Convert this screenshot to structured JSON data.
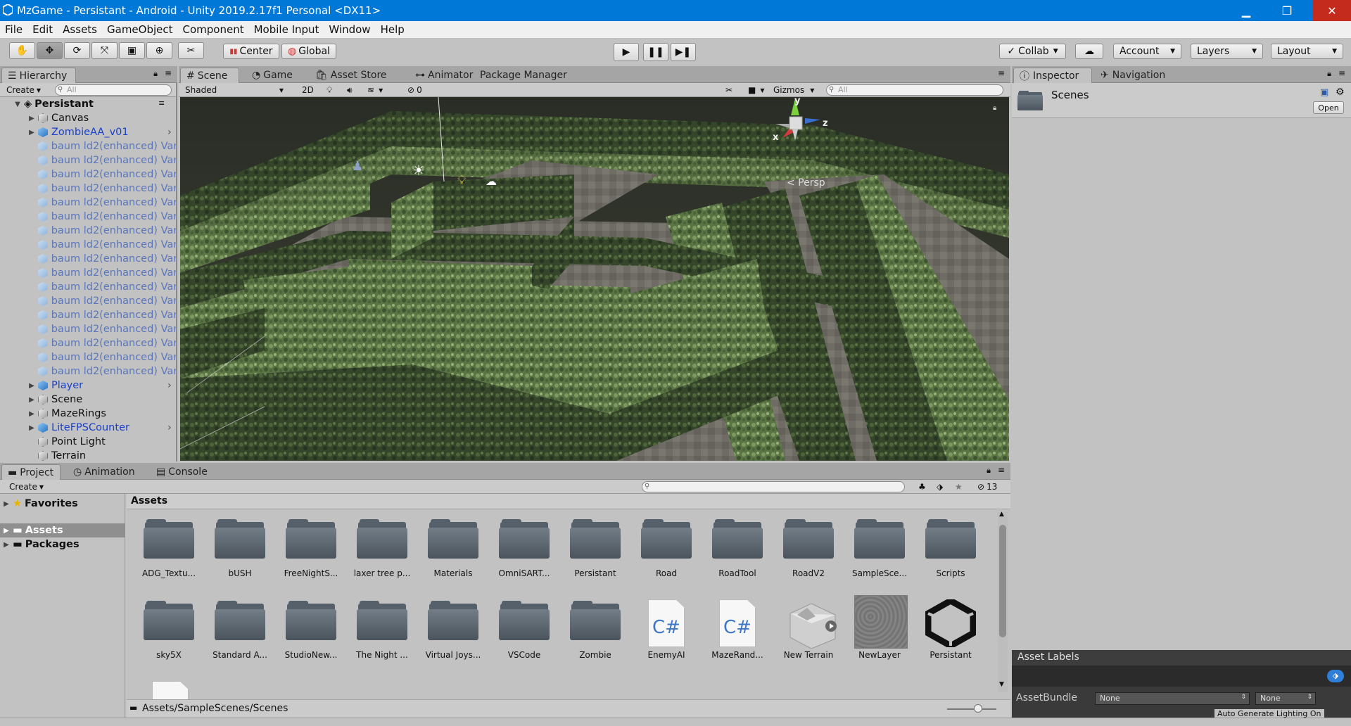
{
  "window": {
    "title": "MzGame - Persistant - Android - Unity 2019.2.17f1 Personal <DX11>",
    "minimize": "▁",
    "maximize": "❐",
    "close": "✕"
  },
  "menu": [
    "File",
    "Edit",
    "Assets",
    "GameObject",
    "Component",
    "Mobile Input",
    "Window",
    "Help"
  ],
  "toolbar": {
    "pivot_label": "Center",
    "space_label": "Global",
    "collab_label": "Collab",
    "account_label": "Account",
    "layers_label": "Layers",
    "layout_label": "Layout"
  },
  "hierarchy": {
    "tab_label": "Hierarchy",
    "create_label": "Create",
    "search_placeholder": "All",
    "scene_name": "Persistant",
    "items": [
      {
        "label": "Canvas",
        "style": "gray",
        "expand": true,
        "color": "#111111",
        "more": false
      },
      {
        "label": "ZombieAA_v01",
        "style": "blue",
        "expand": true,
        "color": "#1a3fc9",
        "more": true
      },
      {
        "label": "baum ld2(enhanced) Var",
        "style": "lightblue",
        "expand": false,
        "color": "#5a75b8",
        "more": false
      },
      {
        "label": "baum ld2(enhanced) Var",
        "style": "lightblue",
        "expand": false,
        "color": "#5a75b8",
        "more": false
      },
      {
        "label": "baum ld2(enhanced) Var",
        "style": "lightblue",
        "expand": false,
        "color": "#5a75b8",
        "more": false
      },
      {
        "label": "baum ld2(enhanced) Var",
        "style": "lightblue",
        "expand": false,
        "color": "#5a75b8",
        "more": false
      },
      {
        "label": "baum ld2(enhanced) Var",
        "style": "lightblue",
        "expand": false,
        "color": "#5a75b8",
        "more": false
      },
      {
        "label": "baum ld2(enhanced) Var",
        "style": "lightblue",
        "expand": false,
        "color": "#5a75b8",
        "more": false
      },
      {
        "label": "baum ld2(enhanced) Var",
        "style": "lightblue",
        "expand": false,
        "color": "#5a75b8",
        "more": false
      },
      {
        "label": "baum ld2(enhanced) Var",
        "style": "lightblue",
        "expand": false,
        "color": "#5a75b8",
        "more": false
      },
      {
        "label": "baum ld2(enhanced) Var",
        "style": "lightblue",
        "expand": false,
        "color": "#5a75b8",
        "more": false
      },
      {
        "label": "baum ld2(enhanced) Var",
        "style": "lightblue",
        "expand": false,
        "color": "#5a75b8",
        "more": false
      },
      {
        "label": "baum ld2(enhanced) Var",
        "style": "lightblue",
        "expand": false,
        "color": "#5a75b8",
        "more": false
      },
      {
        "label": "baum ld2(enhanced) Var",
        "style": "lightblue",
        "expand": false,
        "color": "#5a75b8",
        "more": false
      },
      {
        "label": "baum ld2(enhanced) Var",
        "style": "lightblue",
        "expand": false,
        "color": "#5a75b8",
        "more": false
      },
      {
        "label": "baum ld2(enhanced) Var",
        "style": "lightblue",
        "expand": false,
        "color": "#5a75b8",
        "more": false
      },
      {
        "label": "baum ld2(enhanced) Var",
        "style": "lightblue",
        "expand": false,
        "color": "#5a75b8",
        "more": false
      },
      {
        "label": "baum ld2(enhanced) Var",
        "style": "lightblue",
        "expand": false,
        "color": "#5a75b8",
        "more": false
      },
      {
        "label": "baum ld2(enhanced) Var",
        "style": "lightblue",
        "expand": false,
        "color": "#5a75b8",
        "more": false
      },
      {
        "label": "Player",
        "style": "blue",
        "expand": true,
        "color": "#1a3fc9",
        "more": true
      },
      {
        "label": "Scene",
        "style": "gray",
        "expand": true,
        "color": "#111111",
        "more": false
      },
      {
        "label": "MazeRings",
        "style": "gray",
        "expand": true,
        "color": "#111111",
        "more": false
      },
      {
        "label": "LiteFPSCounter",
        "style": "blue",
        "expand": true,
        "color": "#1a3fc9",
        "more": true
      },
      {
        "label": "Point Light",
        "style": "gray",
        "expand": false,
        "color": "#111111",
        "more": false
      },
      {
        "label": "Terrain",
        "style": "gray",
        "expand": false,
        "color": "#111111",
        "more": false
      }
    ]
  },
  "scene_tabs": {
    "scene": "Scene",
    "game": "Game",
    "asset_store": "Asset Store",
    "animator": "Animator",
    "package_manager": "Package Manager"
  },
  "scene_toolbar": {
    "shading": "Shaded",
    "mode_2d": "2D",
    "hidden_count": "0",
    "gizmos": "Gizmos",
    "search_placeholder": "All",
    "persp_label": "< Persp",
    "axis_x": "x",
    "axis_y": "y",
    "axis_z": "z"
  },
  "inspector": {
    "tab_label": "Inspector",
    "nav_tab_label": "Navigation",
    "selected_name": "Scenes",
    "open_label": "Open",
    "asset_labels_title": "Asset Labels",
    "assetbundle_label": "AssetBundle",
    "bundle_value": "None",
    "variant_value": "None"
  },
  "project": {
    "tabs": {
      "project": "Project",
      "animation": "Animation",
      "console": "Console"
    },
    "create_label": "Create",
    "hidden_count": "13",
    "tree": [
      {
        "label": "Favorites",
        "icon": "star-icon",
        "selected": false
      },
      {
        "label": "Assets",
        "icon": "folder-icon",
        "selected": true
      },
      {
        "label": "Packages",
        "icon": "folder-icon",
        "selected": false
      }
    ],
    "breadcrumb_header": "Assets",
    "path": "Assets/SampleScenes/Scenes",
    "assets": [
      {
        "label": "ADG_Textu...",
        "type": "folder"
      },
      {
        "label": "bUSH",
        "type": "folder"
      },
      {
        "label": "FreeNightS...",
        "type": "folder"
      },
      {
        "label": "laxer tree p...",
        "type": "folder"
      },
      {
        "label": "Materials",
        "type": "folder"
      },
      {
        "label": "OmniSART...",
        "type": "folder"
      },
      {
        "label": "Persistant",
        "type": "folder"
      },
      {
        "label": "Road",
        "type": "folder"
      },
      {
        "label": "RoadTool",
        "type": "folder"
      },
      {
        "label": "RoadV2",
        "type": "folder"
      },
      {
        "label": "SampleSce...",
        "type": "folder"
      },
      {
        "label": "Scripts",
        "type": "folder"
      },
      {
        "label": "sky5X",
        "type": "folder"
      },
      {
        "label": "Standard A...",
        "type": "folder"
      },
      {
        "label": "StudioNew...",
        "type": "folder"
      },
      {
        "label": "The Night ...",
        "type": "folder"
      },
      {
        "label": "Virtual Joys...",
        "type": "folder"
      },
      {
        "label": "VSCode",
        "type": "folder"
      },
      {
        "label": "Zombie",
        "type": "folder"
      },
      {
        "label": "EnemyAI",
        "type": "script"
      },
      {
        "label": "MazeRand...",
        "type": "script"
      },
      {
        "label": "New Terrain",
        "type": "terrain"
      },
      {
        "label": "NewLayer",
        "type": "layer"
      },
      {
        "label": "Persistant",
        "type": "scene"
      }
    ]
  },
  "status": {
    "right_text": "Auto Generate Lighting On"
  },
  "colors": {
    "title_bar": "#0078d7",
    "panel_bg": "#c2c2c2",
    "prefab_blue": "#1a3fc9"
  }
}
